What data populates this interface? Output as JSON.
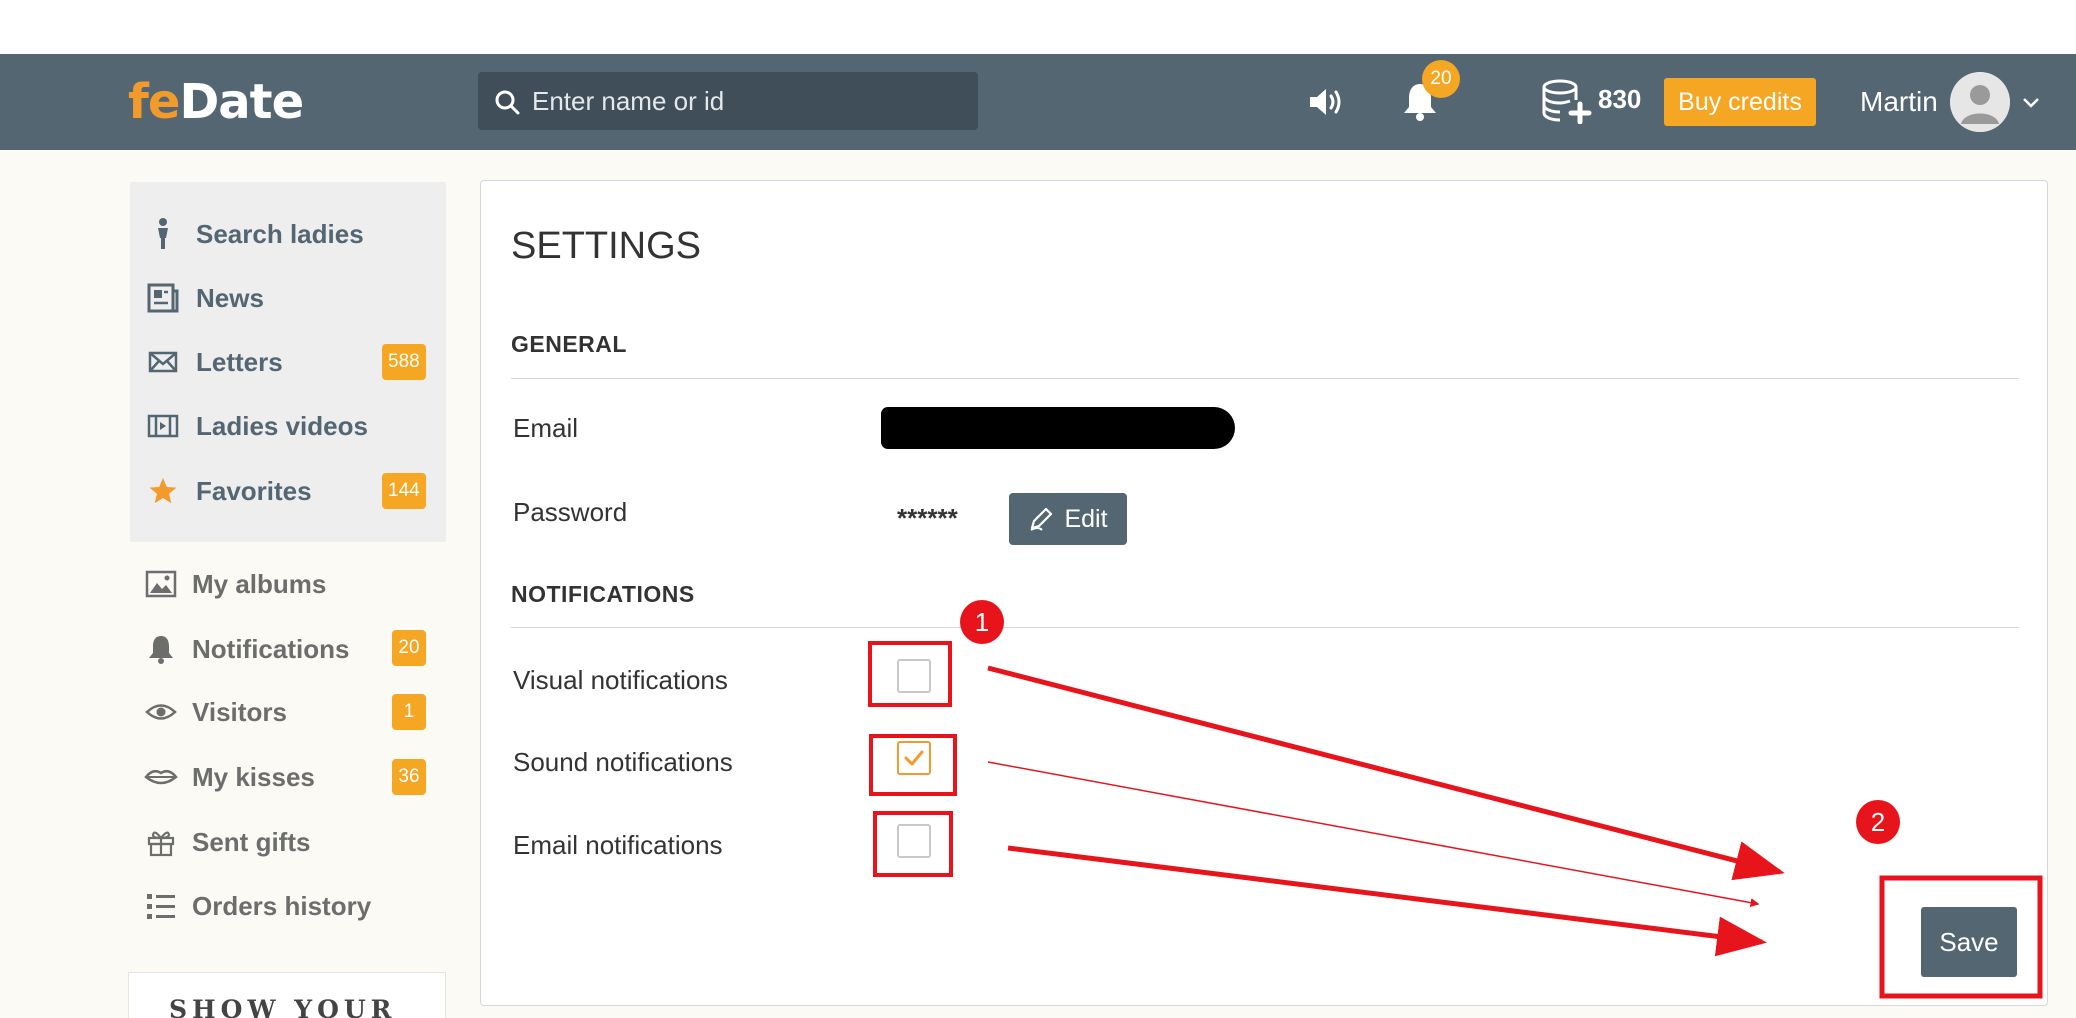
{
  "header": {
    "logo_prefix": "fe",
    "logo_suffix": "Date",
    "search_placeholder": "Enter name or id",
    "notifications_count": "20",
    "credits": "830",
    "buy_credits_label": "Buy credits",
    "user_name": "Martin"
  },
  "sidebar": {
    "primary": [
      {
        "label": "Search ladies",
        "icon": "person-icon"
      },
      {
        "label": "News",
        "icon": "news-icon"
      },
      {
        "label": "Letters",
        "icon": "envelope-icon",
        "badge": "588"
      },
      {
        "label": "Ladies videos",
        "icon": "film-icon"
      },
      {
        "label": "Favorites",
        "icon": "star-icon",
        "badge": "144"
      }
    ],
    "secondary": [
      {
        "label": "My albums",
        "icon": "image-icon"
      },
      {
        "label": "Notifications",
        "icon": "bell-icon",
        "badge": "20"
      },
      {
        "label": "Visitors",
        "icon": "eye-icon",
        "badge": "1"
      },
      {
        "label": "My kisses",
        "icon": "lips-icon",
        "badge": "36"
      },
      {
        "label": "Sent gifts",
        "icon": "gift-icon"
      },
      {
        "label": "Orders history",
        "icon": "list-icon"
      }
    ],
    "promo_text": "SHOW YOUR"
  },
  "settings": {
    "title": "SETTINGS",
    "general_heading": "GENERAL",
    "email_label": "Email",
    "password_label": "Password",
    "password_mask": "******",
    "edit_label": "Edit",
    "notifications_heading": "NOTIFICATIONS",
    "visual_label": "Visual notifications",
    "visual_checked": false,
    "sound_label": "Sound notifications",
    "sound_checked": true,
    "email_notif_label": "Email notifications",
    "email_notif_checked": false,
    "save_label": "Save"
  },
  "annotations": {
    "marker_1": "1",
    "marker_2": "2",
    "color": "#e8141c"
  },
  "colors": {
    "header_bg": "#536672",
    "accent": "#f5a623",
    "logo_accent": "#f39a2d"
  }
}
